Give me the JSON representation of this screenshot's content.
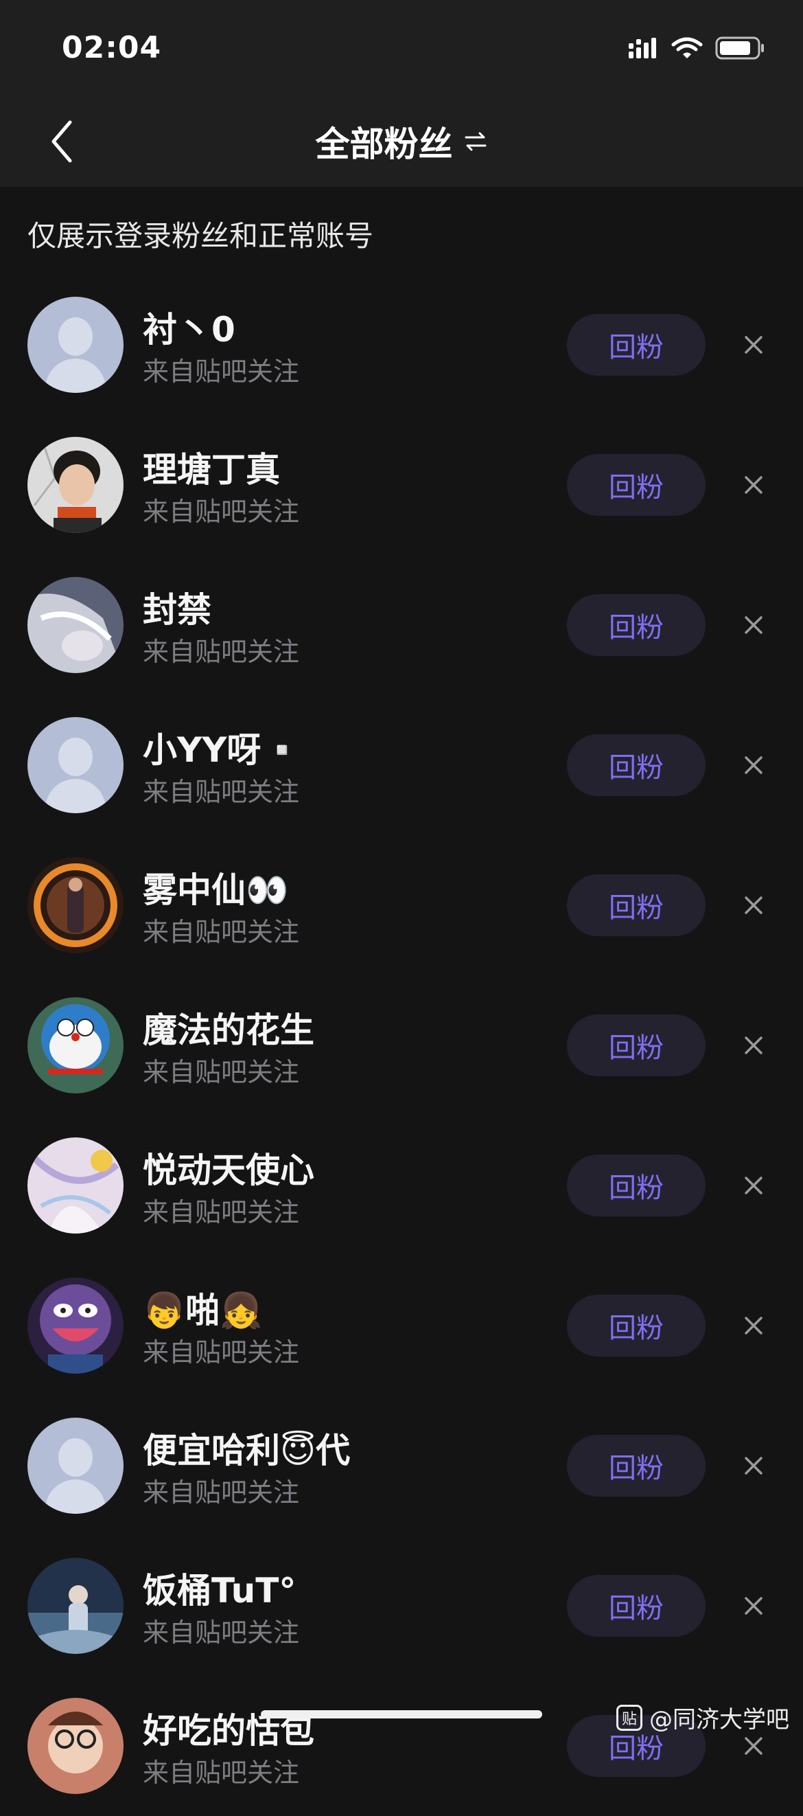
{
  "status_bar": {
    "time": "02:04"
  },
  "nav": {
    "title": "全部粉丝",
    "back_icon": "chevron-left-icon",
    "swap_icon": "swap-arrows-icon"
  },
  "notice": "仅展示登录粉丝和正常账号",
  "followers": [
    {
      "name": "衬丶0",
      "source": "来自贴吧关注",
      "action": "回粉",
      "avatar": "default"
    },
    {
      "name": "理塘丁真",
      "source": "来自贴吧关注",
      "action": "回粉",
      "avatar": "photo"
    },
    {
      "name": "封禁",
      "source": "来自贴吧关注",
      "action": "回粉",
      "avatar": "anime"
    },
    {
      "name": "小YY呀▫️",
      "source": "来自贴吧关注",
      "action": "回粉",
      "avatar": "default"
    },
    {
      "name": "雾中仙👀",
      "source": "来自贴吧关注",
      "action": "回粉",
      "avatar": "portal"
    },
    {
      "name": "魔法的花生",
      "source": "来自贴吧关注",
      "action": "回粉",
      "avatar": "doraemon"
    },
    {
      "name": "悦动天使心",
      "source": "来自贴吧关注",
      "action": "回粉",
      "avatar": "angel"
    },
    {
      "name": "👦啪👧",
      "source": "来自贴吧关注",
      "action": "回粉",
      "avatar": "monster"
    },
    {
      "name": "便宜哈利😇代",
      "source": "来自贴吧关注",
      "action": "回粉",
      "avatar": "default"
    },
    {
      "name": "饭桶TuT°",
      "source": "来自贴吧关注",
      "action": "回粉",
      "avatar": "scene"
    },
    {
      "name": "好吃的恬包",
      "source": "来自贴吧关注",
      "action": "回粉",
      "avatar": "kid"
    }
  ],
  "watermark": {
    "logo_text": "贴",
    "text": "@同济大学吧"
  },
  "colors": {
    "background": "#141415",
    "header": "#1f1f20",
    "accent": "#7e6ff2",
    "button_bg": "#24222f"
  }
}
